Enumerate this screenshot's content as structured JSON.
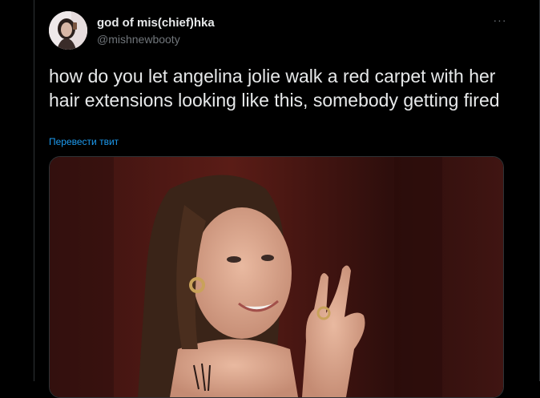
{
  "tweet": {
    "display_name": "god of mis(chief)hka",
    "handle": "@mishnewbooty",
    "more_icon": "more-dots-icon",
    "text": "how do you let angelina jolie walk a red carpet with her hair extensions looking like this, somebody getting fired",
    "translate_label": "Перевести твит"
  },
  "colors": {
    "background": "#000000",
    "text": "#e7e9ea",
    "secondary": "#71767b",
    "link": "#1d9bf0",
    "border": "#2f3336"
  }
}
